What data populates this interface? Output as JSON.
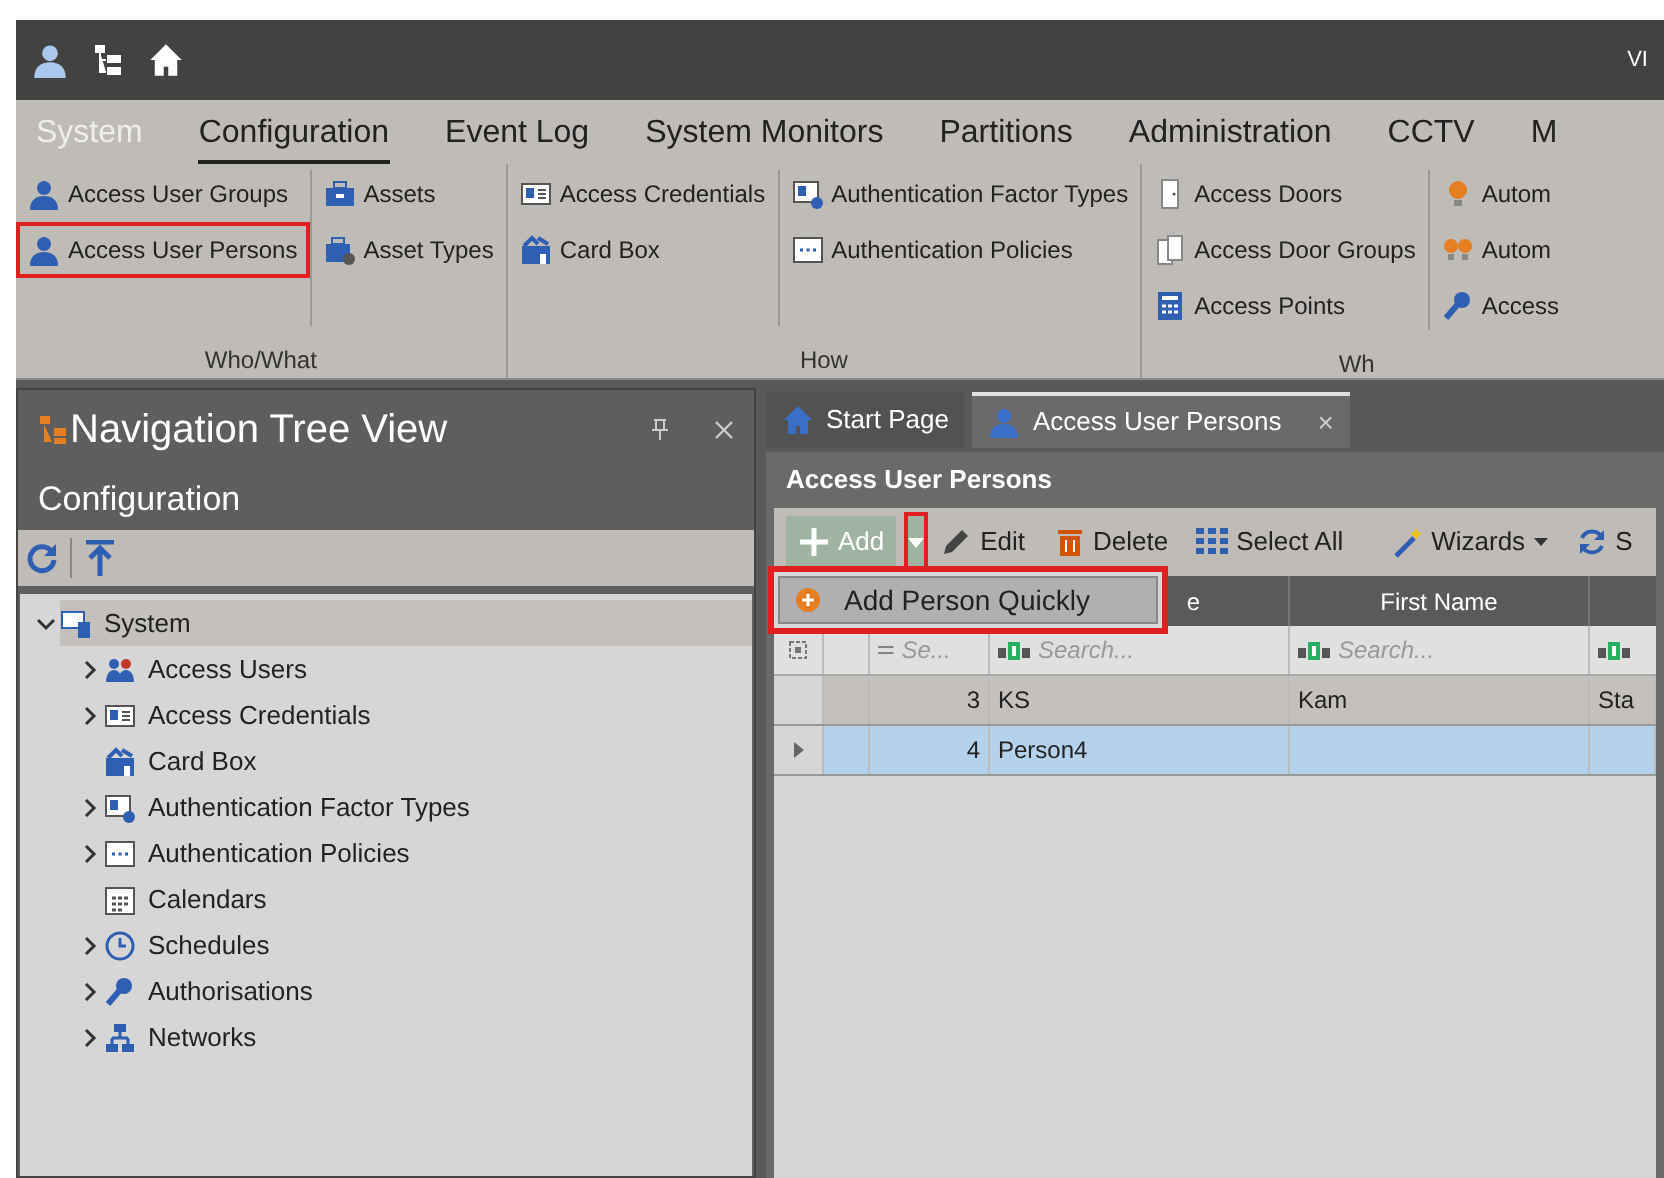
{
  "title_bar": {
    "right_text": "VI"
  },
  "menu_tabs": [
    {
      "label": "System",
      "selected": false,
      "kind": "app"
    },
    {
      "label": "Configuration",
      "selected": true,
      "kind": "tab"
    },
    {
      "label": "Event Log",
      "selected": false,
      "kind": "tab"
    },
    {
      "label": "System Monitors",
      "selected": false,
      "kind": "tab"
    },
    {
      "label": "Partitions",
      "selected": false,
      "kind": "tab"
    },
    {
      "label": "Administration",
      "selected": false,
      "kind": "tab"
    },
    {
      "label": "CCTV",
      "selected": false,
      "kind": "tab"
    },
    {
      "label": "M",
      "selected": false,
      "kind": "tab"
    }
  ],
  "ribbon_groups": [
    {
      "label": "Who/What",
      "columns": [
        [
          {
            "label": "Access User Groups",
            "highlighted": false
          },
          {
            "label": "Access User Persons",
            "highlighted": true
          }
        ],
        [
          {
            "label": "Assets",
            "highlighted": false
          },
          {
            "label": "Asset Types",
            "highlighted": false
          }
        ]
      ]
    },
    {
      "label": "How",
      "columns": [
        [
          {
            "label": "Access Credentials",
            "highlighted": false
          },
          {
            "label": "Card Box",
            "highlighted": false
          }
        ],
        [
          {
            "label": "Authentication Factor Types",
            "highlighted": false
          },
          {
            "label": "Authentication Policies",
            "highlighted": false
          }
        ]
      ]
    },
    {
      "label": "Wh",
      "columns": [
        [
          {
            "label": "Access Doors",
            "highlighted": false
          },
          {
            "label": "Access Door Groups",
            "highlighted": false
          },
          {
            "label": "Access Points",
            "highlighted": false
          }
        ],
        [
          {
            "label": "Autom",
            "highlighted": false
          },
          {
            "label": "Autom",
            "highlighted": false
          },
          {
            "label": "Access",
            "highlighted": false
          }
        ]
      ]
    }
  ],
  "nav_panel": {
    "title": "Navigation Tree View",
    "subtitle": "Configuration",
    "tree": [
      {
        "label": "System",
        "expanded": true,
        "selected": true,
        "children": [
          {
            "label": "Access Users",
            "expanded": false,
            "selected": false
          },
          {
            "label": "Access Credentials",
            "expanded": false,
            "selected": false
          },
          {
            "label": "Card Box",
            "selected": false
          },
          {
            "label": "Authentication Factor Types",
            "expanded": false,
            "selected": false
          },
          {
            "label": "Authentication Policies",
            "expanded": false,
            "selected": false
          },
          {
            "label": "Calendars",
            "selected": false
          },
          {
            "label": "Schedules",
            "expanded": false,
            "selected": false
          },
          {
            "label": "Authorisations",
            "expanded": false,
            "selected": false
          },
          {
            "label": "Networks",
            "expanded": false,
            "selected": false
          }
        ]
      }
    ]
  },
  "doc_tabs": [
    {
      "label": "Start Page",
      "selected": false,
      "closable": false
    },
    {
      "label": "Access User Persons",
      "selected": true,
      "closable": true
    }
  ],
  "close_glyph": "×",
  "content": {
    "title": "Access User Persons",
    "toolbar": [
      {
        "label": "Add",
        "kind": "add",
        "highlighted": false
      },
      {
        "kind": "dropdown",
        "highlighted": true
      },
      {
        "label": "Edit",
        "kind": "edit"
      },
      {
        "label": "Delete",
        "kind": "delete"
      },
      {
        "label": "Select All",
        "kind": "selectall"
      },
      {
        "kind": "separator"
      },
      {
        "label": "Wizards",
        "kind": "wizards"
      },
      {
        "label": "S",
        "kind": "refresh"
      }
    ],
    "dropdown_menu": {
      "highlighted": true,
      "items": [
        {
          "label": "Add Person Quickly"
        }
      ]
    },
    "table": {
      "columns": [
        "e",
        "First Name"
      ],
      "filters": [
        {
          "placeholder": "Se..."
        },
        {
          "placeholder": "Search..."
        },
        {
          "placeholder": "Search..."
        }
      ],
      "rows": [
        {
          "id": "3",
          "cells": [
            "KS",
            "Kam",
            "Sta"
          ],
          "selected": false
        },
        {
          "id": "4",
          "cells": [
            "Person4",
            "",
            ""
          ],
          "selected": true
        }
      ]
    }
  }
}
